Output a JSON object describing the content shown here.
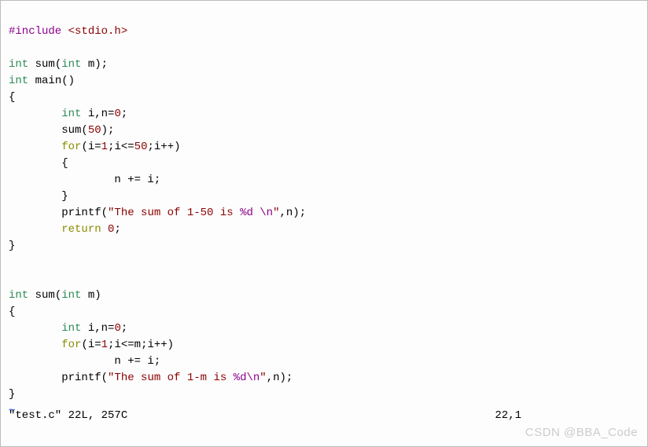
{
  "code": {
    "line1": {
      "preproc": "#include ",
      "header": "<stdio.h>"
    },
    "line3": {
      "type1": "int",
      "space1": " ",
      "func": "sum(",
      "type2": "int",
      "rest": " m);"
    },
    "line4": {
      "type": "int",
      "space": " ",
      "func": "main()"
    },
    "line5": "{",
    "line6": {
      "indent": "        ",
      "type": "int",
      "rest": " i,n=",
      "num": "0",
      "semi": ";"
    },
    "line7": {
      "indent": "        ",
      "func": "sum(",
      "num": "50",
      "rest": ");"
    },
    "line8": {
      "indent": "        ",
      "kw": "for",
      "open": "(i=",
      "n1": "1",
      "mid": ";i<=",
      "n2": "50",
      "rest": ";i++)"
    },
    "line9": {
      "indent": "        ",
      "brace": "{"
    },
    "line10": {
      "indent": "                ",
      "body": "n += i;"
    },
    "line11": {
      "indent": "        ",
      "brace": "}"
    },
    "line12": {
      "indent": "        ",
      "func": "printf(",
      "str": "\"The sum of 1-50 is ",
      "fmt": "%d",
      "esc": " \\n",
      "endq": "\"",
      "rest": ",n);"
    },
    "line13": {
      "indent": "        ",
      "kw": "return",
      "space": " ",
      "num": "0",
      "semi": ";"
    },
    "line14": "}",
    "line17": {
      "type1": "int",
      "space1": " ",
      "func": "sum(",
      "type2": "int",
      "rest": " m)"
    },
    "line18": "{",
    "line19": {
      "indent": "        ",
      "type": "int",
      "rest": " i,n=",
      "num": "0",
      "semi": ";"
    },
    "line20": {
      "indent": "        ",
      "kw": "for",
      "open": "(i=",
      "n1": "1",
      "mid": ";i<=m;i++)",
      "rest": ""
    },
    "line21": {
      "indent": "                ",
      "body": "n += i;"
    },
    "line22": {
      "indent": "        ",
      "func": "printf(",
      "str": "\"The sum of 1-m is ",
      "fmt": "%d",
      "esc": "\\n",
      "endq": "\"",
      "rest": ",n);"
    },
    "line23": "}",
    "tilde": "~"
  },
  "status": {
    "left": "\"test.c\" 22L, 257C",
    "right": "22,1"
  },
  "watermark": "CSDN @BBA_Code"
}
